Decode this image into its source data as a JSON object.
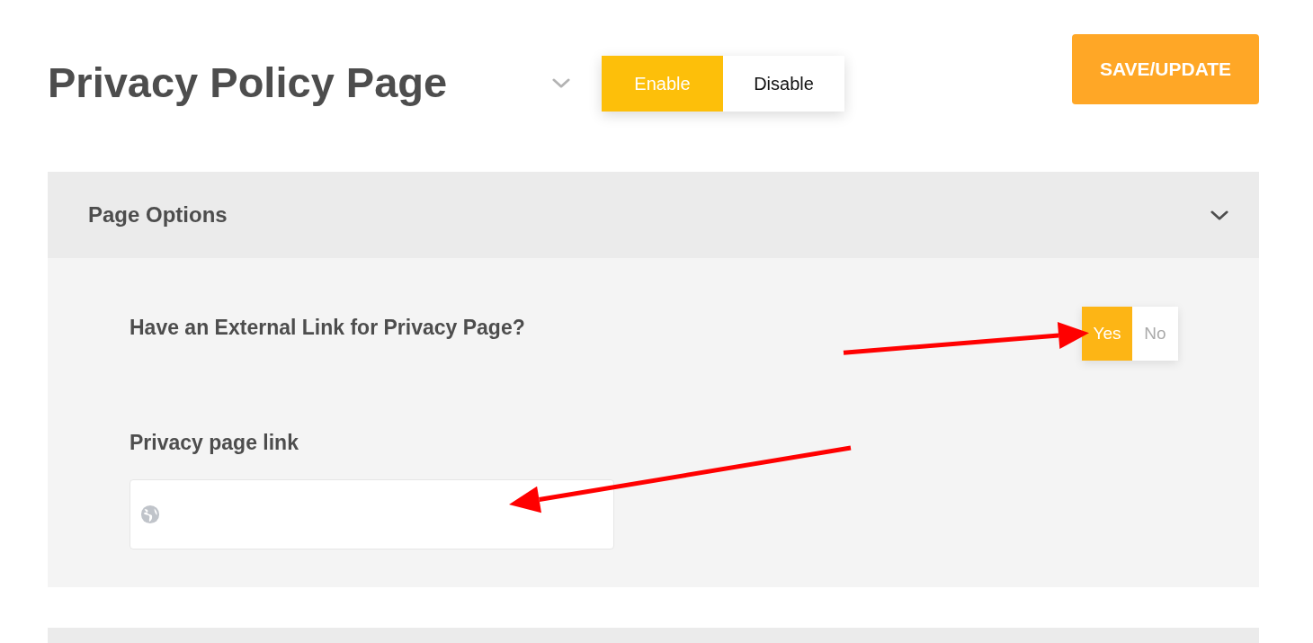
{
  "page": {
    "title": "Privacy Policy Page"
  },
  "status_toggle": [
    {
      "label": "Enable",
      "selected": true
    },
    {
      "label": "Disable",
      "selected": false
    }
  ],
  "save_button": {
    "label": "SAVE/UPDATE"
  },
  "panel": {
    "title": "Page Options",
    "expanded": true,
    "external_link": {
      "label": "Have an External Link for Privacy Page?",
      "options": [
        {
          "label": "Yes",
          "selected": true
        },
        {
          "label": "No",
          "selected": false
        }
      ]
    },
    "link_field": {
      "label": "Privacy page link"
    }
  }
}
